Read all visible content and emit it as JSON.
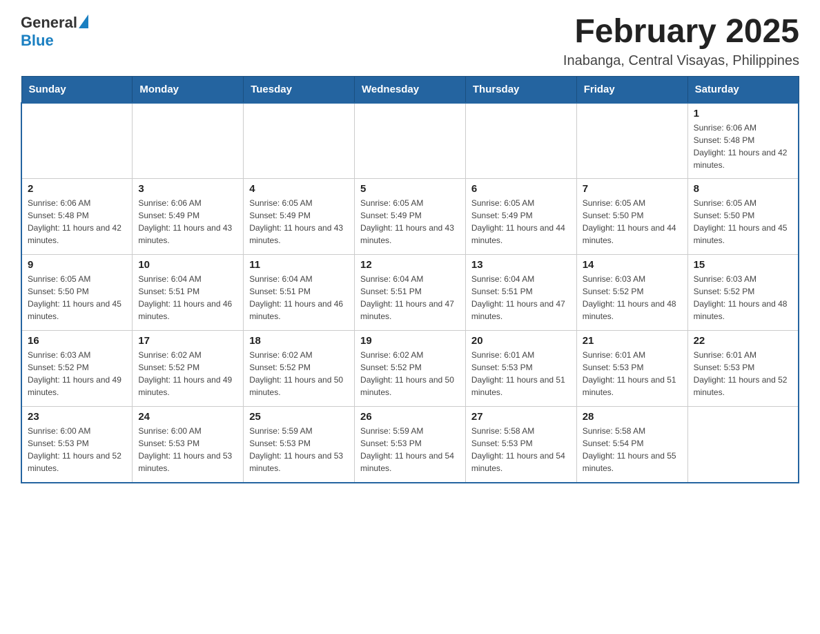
{
  "header": {
    "logo_general": "General",
    "logo_blue": "Blue",
    "title": "February 2025",
    "subtitle": "Inabanga, Central Visayas, Philippines"
  },
  "weekdays": [
    "Sunday",
    "Monday",
    "Tuesday",
    "Wednesday",
    "Thursday",
    "Friday",
    "Saturday"
  ],
  "weeks": [
    [
      {
        "day": "",
        "sunrise": "",
        "sunset": "",
        "daylight": ""
      },
      {
        "day": "",
        "sunrise": "",
        "sunset": "",
        "daylight": ""
      },
      {
        "day": "",
        "sunrise": "",
        "sunset": "",
        "daylight": ""
      },
      {
        "day": "",
        "sunrise": "",
        "sunset": "",
        "daylight": ""
      },
      {
        "day": "",
        "sunrise": "",
        "sunset": "",
        "daylight": ""
      },
      {
        "day": "",
        "sunrise": "",
        "sunset": "",
        "daylight": ""
      },
      {
        "day": "1",
        "sunrise": "Sunrise: 6:06 AM",
        "sunset": "Sunset: 5:48 PM",
        "daylight": "Daylight: 11 hours and 42 minutes."
      }
    ],
    [
      {
        "day": "2",
        "sunrise": "Sunrise: 6:06 AM",
        "sunset": "Sunset: 5:48 PM",
        "daylight": "Daylight: 11 hours and 42 minutes."
      },
      {
        "day": "3",
        "sunrise": "Sunrise: 6:06 AM",
        "sunset": "Sunset: 5:49 PM",
        "daylight": "Daylight: 11 hours and 43 minutes."
      },
      {
        "day": "4",
        "sunrise": "Sunrise: 6:05 AM",
        "sunset": "Sunset: 5:49 PM",
        "daylight": "Daylight: 11 hours and 43 minutes."
      },
      {
        "day": "5",
        "sunrise": "Sunrise: 6:05 AM",
        "sunset": "Sunset: 5:49 PM",
        "daylight": "Daylight: 11 hours and 43 minutes."
      },
      {
        "day": "6",
        "sunrise": "Sunrise: 6:05 AM",
        "sunset": "Sunset: 5:49 PM",
        "daylight": "Daylight: 11 hours and 44 minutes."
      },
      {
        "day": "7",
        "sunrise": "Sunrise: 6:05 AM",
        "sunset": "Sunset: 5:50 PM",
        "daylight": "Daylight: 11 hours and 44 minutes."
      },
      {
        "day": "8",
        "sunrise": "Sunrise: 6:05 AM",
        "sunset": "Sunset: 5:50 PM",
        "daylight": "Daylight: 11 hours and 45 minutes."
      }
    ],
    [
      {
        "day": "9",
        "sunrise": "Sunrise: 6:05 AM",
        "sunset": "Sunset: 5:50 PM",
        "daylight": "Daylight: 11 hours and 45 minutes."
      },
      {
        "day": "10",
        "sunrise": "Sunrise: 6:04 AM",
        "sunset": "Sunset: 5:51 PM",
        "daylight": "Daylight: 11 hours and 46 minutes."
      },
      {
        "day": "11",
        "sunrise": "Sunrise: 6:04 AM",
        "sunset": "Sunset: 5:51 PM",
        "daylight": "Daylight: 11 hours and 46 minutes."
      },
      {
        "day": "12",
        "sunrise": "Sunrise: 6:04 AM",
        "sunset": "Sunset: 5:51 PM",
        "daylight": "Daylight: 11 hours and 47 minutes."
      },
      {
        "day": "13",
        "sunrise": "Sunrise: 6:04 AM",
        "sunset": "Sunset: 5:51 PM",
        "daylight": "Daylight: 11 hours and 47 minutes."
      },
      {
        "day": "14",
        "sunrise": "Sunrise: 6:03 AM",
        "sunset": "Sunset: 5:52 PM",
        "daylight": "Daylight: 11 hours and 48 minutes."
      },
      {
        "day": "15",
        "sunrise": "Sunrise: 6:03 AM",
        "sunset": "Sunset: 5:52 PM",
        "daylight": "Daylight: 11 hours and 48 minutes."
      }
    ],
    [
      {
        "day": "16",
        "sunrise": "Sunrise: 6:03 AM",
        "sunset": "Sunset: 5:52 PM",
        "daylight": "Daylight: 11 hours and 49 minutes."
      },
      {
        "day": "17",
        "sunrise": "Sunrise: 6:02 AM",
        "sunset": "Sunset: 5:52 PM",
        "daylight": "Daylight: 11 hours and 49 minutes."
      },
      {
        "day": "18",
        "sunrise": "Sunrise: 6:02 AM",
        "sunset": "Sunset: 5:52 PM",
        "daylight": "Daylight: 11 hours and 50 minutes."
      },
      {
        "day": "19",
        "sunrise": "Sunrise: 6:02 AM",
        "sunset": "Sunset: 5:52 PM",
        "daylight": "Daylight: 11 hours and 50 minutes."
      },
      {
        "day": "20",
        "sunrise": "Sunrise: 6:01 AM",
        "sunset": "Sunset: 5:53 PM",
        "daylight": "Daylight: 11 hours and 51 minutes."
      },
      {
        "day": "21",
        "sunrise": "Sunrise: 6:01 AM",
        "sunset": "Sunset: 5:53 PM",
        "daylight": "Daylight: 11 hours and 51 minutes."
      },
      {
        "day": "22",
        "sunrise": "Sunrise: 6:01 AM",
        "sunset": "Sunset: 5:53 PM",
        "daylight": "Daylight: 11 hours and 52 minutes."
      }
    ],
    [
      {
        "day": "23",
        "sunrise": "Sunrise: 6:00 AM",
        "sunset": "Sunset: 5:53 PM",
        "daylight": "Daylight: 11 hours and 52 minutes."
      },
      {
        "day": "24",
        "sunrise": "Sunrise: 6:00 AM",
        "sunset": "Sunset: 5:53 PM",
        "daylight": "Daylight: 11 hours and 53 minutes."
      },
      {
        "day": "25",
        "sunrise": "Sunrise: 5:59 AM",
        "sunset": "Sunset: 5:53 PM",
        "daylight": "Daylight: 11 hours and 53 minutes."
      },
      {
        "day": "26",
        "sunrise": "Sunrise: 5:59 AM",
        "sunset": "Sunset: 5:53 PM",
        "daylight": "Daylight: 11 hours and 54 minutes."
      },
      {
        "day": "27",
        "sunrise": "Sunrise: 5:58 AM",
        "sunset": "Sunset: 5:53 PM",
        "daylight": "Daylight: 11 hours and 54 minutes."
      },
      {
        "day": "28",
        "sunrise": "Sunrise: 5:58 AM",
        "sunset": "Sunset: 5:54 PM",
        "daylight": "Daylight: 11 hours and 55 minutes."
      },
      {
        "day": "",
        "sunrise": "",
        "sunset": "",
        "daylight": ""
      }
    ]
  ]
}
